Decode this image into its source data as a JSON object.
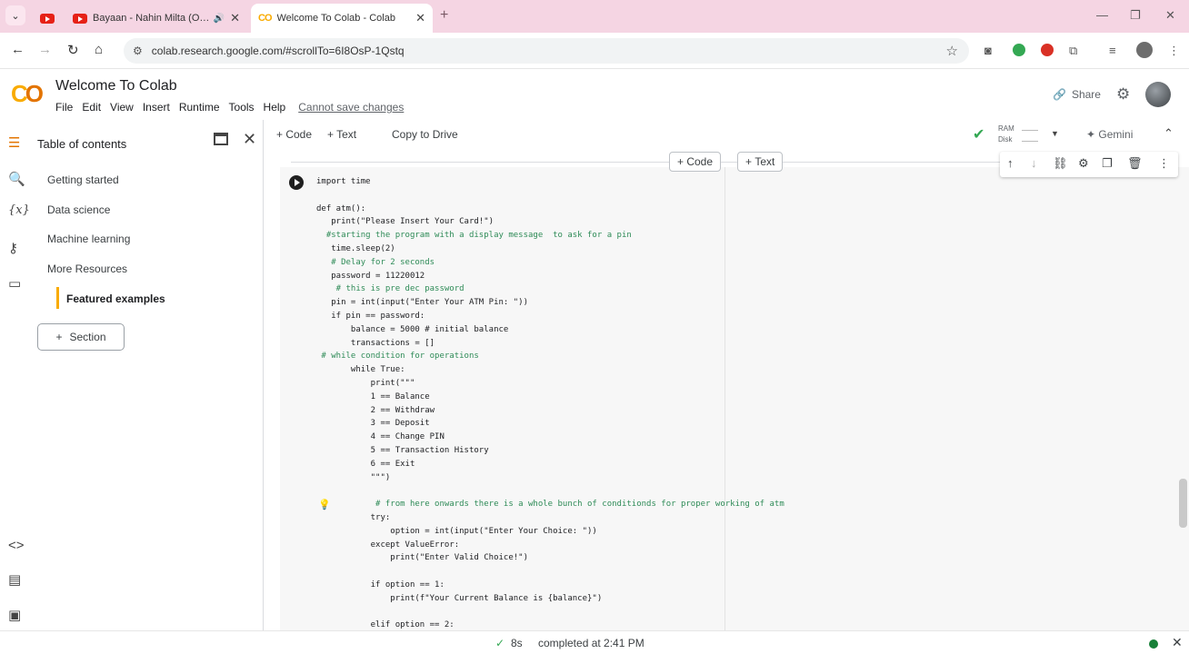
{
  "browser": {
    "tabs": [
      {
        "title": "",
        "icon": "youtube-icon"
      },
      {
        "title": "Bayaan - Nahin Milta (Offic",
        "icon": "youtube-icon"
      },
      {
        "title": "Welcome To Colab - Colab",
        "icon": "colab-icon"
      }
    ],
    "url": "colab.research.google.com/#scrollTo=6I8OsP-1Qstq"
  },
  "colab": {
    "notebook_title": "Welcome To Colab",
    "menu": [
      "File",
      "Edit",
      "View",
      "Insert",
      "Runtime",
      "Tools",
      "Help"
    ],
    "cannot_save": "Cannot save changes",
    "share_label": "Share"
  },
  "toc": {
    "title": "Table of contents",
    "items": [
      "Getting started",
      "Data science",
      "Machine learning",
      "More Resources"
    ],
    "active_item": "Featured examples",
    "section_button": "Section"
  },
  "toolbar": {
    "code_label": "Code",
    "text_label": "Text",
    "copy_to_drive": "Copy to Drive",
    "ram_label": "RAM",
    "disk_label": "Disk",
    "gemini_label": "Gemini"
  },
  "cell": {
    "add_code": "Code",
    "add_text": "Text",
    "code_lines": [
      "import time",
      "",
      "def atm():",
      "   print(\"Please Insert Your Card!\")",
      "  #starting the program with a display message  to ask for a pin",
      "   time.sleep(2)",
      "   # Delay for 2 seconds",
      "   password = 11220012",
      "    # this is pre dec password",
      "   pin = int(input(\"Enter Your ATM Pin: \"))",
      "   if pin == password:",
      "       balance = 5000 # initial balance",
      "       transactions = []",
      " # while condition for operations",
      "       while True:",
      "           print(\"\"\"",
      "           1 == Balance",
      "           2 == Withdraw",
      "           3 == Deposit",
      "           4 == Change PIN",
      "           5 == Transaction History",
      "           6 == Exit",
      "           \"\"\")",
      "",
      "            # from here onwards there is a whole bunch of conditionds for proper working of atm",
      "           try:",
      "               option = int(input(\"Enter Your Choice: \"))",
      "           except ValueError:",
      "               print(\"Enter Valid Choice!\")",
      "",
      "           if option == 1:",
      "               print(f\"Your Current Balance is {balance}\")",
      "",
      "           elif option == 2:"
    ]
  },
  "status": {
    "duration": "8s",
    "completed": "completed at 2:41 PM"
  },
  "colors": {
    "accent_orange": "#f9ab00",
    "tab_strip": "#f5d5e3",
    "ok_green": "#34a853"
  }
}
